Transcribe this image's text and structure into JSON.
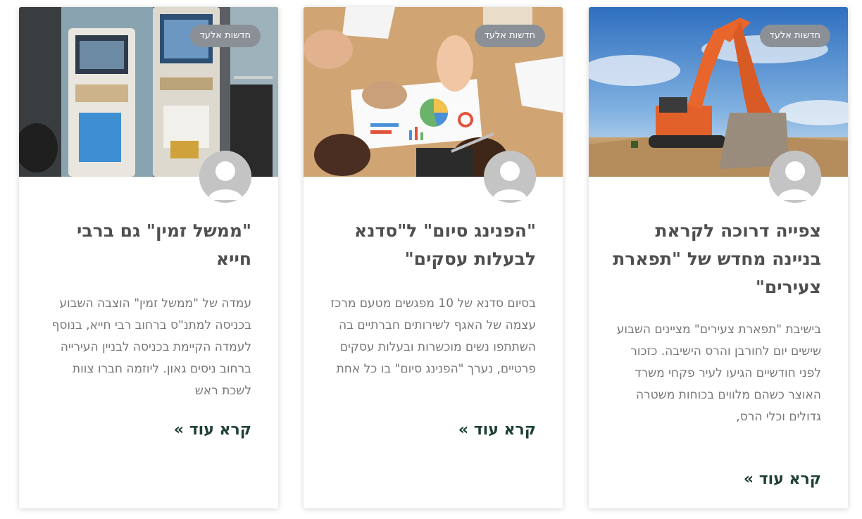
{
  "posts": [
    {
      "category": "חדשות אלעד",
      "image": "excavator-construction-photo",
      "avatar": "default-user-avatar",
      "title": "צפייה דרוכה לקראת בניינה מחדש של \"תפארת צעירים\"",
      "excerpt": "בישיבת \"תפארת צעירים\" מציינים השבוע שישים יום לחורבן והרס הישיבה. כזכור לפני חודשיים הגיעו לעיר פקחי משרד האוצר כשהם מלווים בכוחות משטרה גדולים וכלי הרס,",
      "read_more": "קרא עוד »"
    },
    {
      "category": "חדשות אלעד",
      "image": "business-meeting-charts-photo",
      "avatar": "default-user-avatar",
      "title": "\"הפנינג סיום\" ל\"סדנא לבעלות עסקים\"",
      "excerpt": "בסיום סדנא של 10 מפגשים מטעם מרכז עצמה של האגף לשירותים חברתיים בה השתתפו נשים מוכשרות ובעלות עסקים פרטיים, נערך \"הפנינג סיום\" בו כל אחת",
      "read_more": "קרא עוד »"
    },
    {
      "category": "חדשות אלעד",
      "image": "government-kiosk-machines-photo",
      "avatar": "default-user-avatar",
      "title": "\"ממשל זמין\" גם ברבי חייא",
      "excerpt": "עמדה של \"ממשל זמין\" הוצבה השבוע בכניסה למתנ\"ס ברחוב רבי חייא, בנוסף לעמדה הקיימת בכניסה לבניין העירייה ברחוב ניסים גאון. ליוזמה חברו צוות לשכת ראש",
      "read_more": "קרא עוד »"
    }
  ],
  "colors": {
    "badge_bg": "#8a9095",
    "title": "#4f4f4f",
    "excerpt": "#777777",
    "link": "#1f4037",
    "avatar": "#c4c4c4"
  }
}
